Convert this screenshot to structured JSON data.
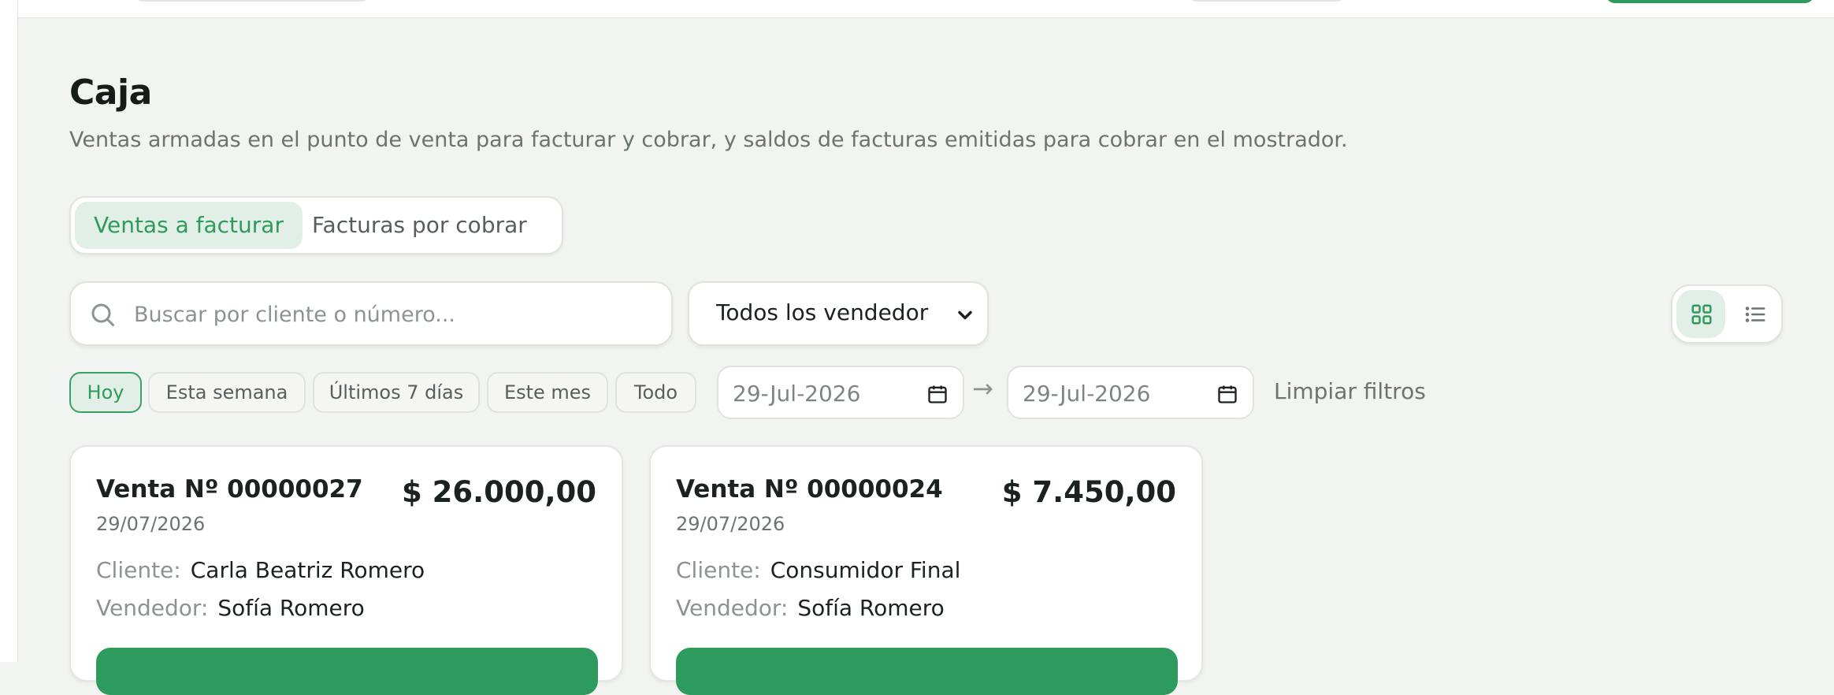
{
  "header": {
    "title": "Caja",
    "subtitle": "Ventas armadas en el punto de venta para facturar y cobrar, y saldos de facturas emitidas para cobrar en el mostrador."
  },
  "tabs": [
    {
      "label": "Ventas a facturar",
      "active": true
    },
    {
      "label": "Facturas por cobrar",
      "active": false
    }
  ],
  "search": {
    "placeholder": "Buscar por cliente o número...",
    "value": ""
  },
  "vendor_filter": {
    "selected": "Todos los vendedores"
  },
  "view_toggle": {
    "active": "grid",
    "icons": [
      "grid-icon",
      "list-icon"
    ]
  },
  "quick_filters": [
    {
      "label": "Hoy",
      "active": true
    },
    {
      "label": "Esta semana",
      "active": false
    },
    {
      "label": "Últimos 7 días",
      "active": false
    },
    {
      "label": "Este mes",
      "active": false
    },
    {
      "label": "Todo",
      "active": false
    }
  ],
  "date_range": {
    "from": "29-Jul-2026",
    "arrow": "→",
    "to": "29-Jul-2026"
  },
  "clear_filters_label": "Limpiar filtros",
  "cards": [
    {
      "title": "Venta Nº 00000027",
      "date": "29/07/2026",
      "amount": "$ 26.000,00",
      "client_label": "Cliente:",
      "client": "Carla Beatriz Romero",
      "seller_label": "Vendedor:",
      "seller": "Sofía Romero"
    },
    {
      "title": "Venta Nº 00000024",
      "date": "29/07/2026",
      "amount": "$ 7.450,00",
      "client_label": "Cliente:",
      "client": "Consumidor Final",
      "seller_label": "Vendedor:",
      "seller": "Sofía Romero"
    }
  ],
  "colors": {
    "accent": "#2e9a5b",
    "accent_soft": "#e2efe6",
    "background": "#f2f4f1",
    "border": "#dfe3de"
  }
}
